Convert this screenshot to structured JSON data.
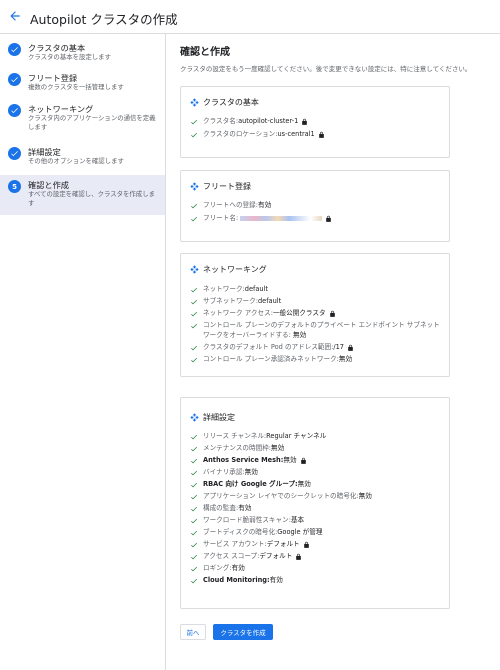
{
  "header": {
    "title": "Autopilot クラスタの作成"
  },
  "colors": {
    "accent": "#1a73e8",
    "check": "#188038",
    "active_step_bg": "#e8eaf6"
  },
  "sidebar": {
    "steps": [
      {
        "title": "クラスタの基本",
        "desc": "クラスタの基本を設定します",
        "status": "done"
      },
      {
        "title": "フリート登録",
        "desc": "複数のクラスタを一括管理します",
        "status": "done"
      },
      {
        "title": "ネットワーキング",
        "desc": "クラスタ内のアプリケーションの通信を定義します",
        "status": "done"
      },
      {
        "title": "詳細設定",
        "desc": "その他のオプションを確認します",
        "status": "done"
      },
      {
        "number": "5",
        "title": "確認と作成",
        "desc": "すべての設定を確認し、クラスタを作成します",
        "status": "active"
      }
    ]
  },
  "main": {
    "title": "確認と作成",
    "description": "クラスタの設定をもう一度確認してください。後で変更できない設定には、特に注意してください。",
    "cards": {
      "basics": {
        "title": "クラスタの基本",
        "rows": [
          {
            "label": "クラスタ名: ",
            "value": "autopilot-cluster-1"
          },
          {
            "label": "クラスタのロケーション: ",
            "value": "us-central1"
          }
        ]
      },
      "fleet": {
        "title": "フリート登録",
        "rows": [
          {
            "label": "フリートへの登録: ",
            "value": "有効"
          },
          {
            "label": "フリート名: ",
            "value": "-"
          }
        ]
      },
      "networking": {
        "title": "ネットワーキング",
        "rows": [
          {
            "label": "ネットワーク: ",
            "value": "default"
          },
          {
            "label": "サブネットワーク: ",
            "value": "default"
          },
          {
            "label": "ネットワーク アクセス: ",
            "value": "一般公開クラスタ"
          },
          {
            "label": "コントロール プレーンのデフォルトのプライベート エンドポイント サブネットワークをオーバーライドする: ",
            "value": "無効"
          },
          {
            "label": "クラスタのデフォルト Pod のアドレス範囲: ",
            "value": "/17"
          },
          {
            "label": "コントロール プレーン承認済みネットワーク: ",
            "value": "無効"
          }
        ]
      },
      "advanced": {
        "title": "詳細設定",
        "rows": [
          {
            "label": "リリース チャンネル: ",
            "value": "Regular チャンネル"
          },
          {
            "label": "メンテナンスの時間枠: ",
            "value": "無効"
          },
          {
            "label": "Anthos Service Mesh: ",
            "value": "無効"
          },
          {
            "label": "バイナリ承認: ",
            "value": "無効"
          },
          {
            "label": "RBAC 向け Google グループ: ",
            "value": "無効"
          },
          {
            "label": "アプリケーション レイヤでのシークレットの暗号化: ",
            "value": "無効"
          },
          {
            "label": "構成の監査: ",
            "value": "有効"
          },
          {
            "label": "ワークロード脆弱性スキャン: ",
            "value": "基本"
          },
          {
            "label": "ブートディスクの暗号化: ",
            "value": "Google が管理"
          },
          {
            "label": "サービス アカウント: ",
            "value": "デフォルト"
          },
          {
            "label": "アクセス スコープ: ",
            "value": "デフォルト"
          },
          {
            "label": "ロギング: ",
            "value": "有効"
          },
          {
            "label": "Cloud Monitoring: ",
            "value": "有効"
          }
        ]
      }
    },
    "buttons": {
      "prev": "前へ",
      "create": "クラスタを作成"
    }
  }
}
